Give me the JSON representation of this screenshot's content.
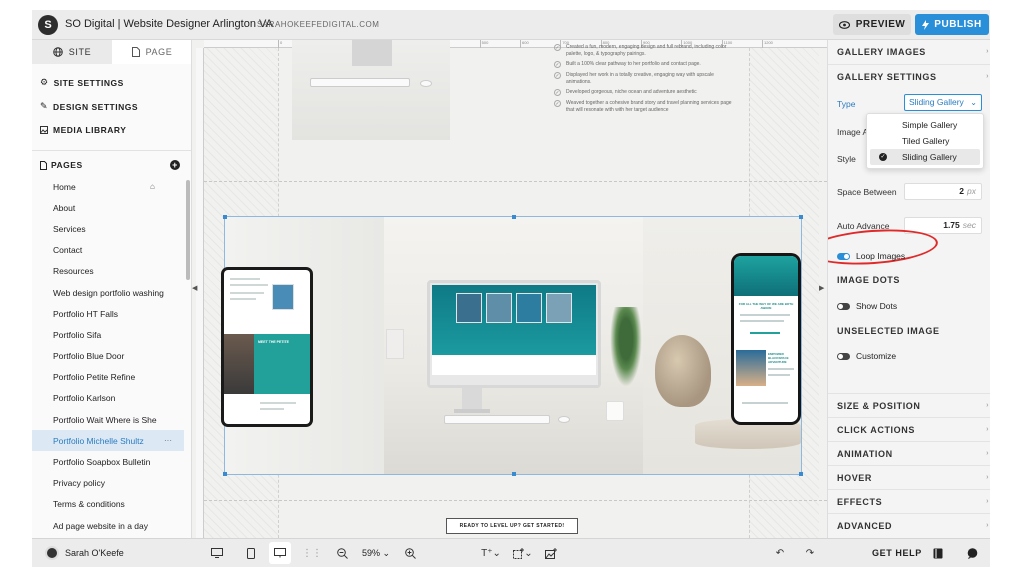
{
  "topbar": {
    "logo_glyph": "S",
    "site_title": "SO Digital | Website Designer Arlington VA",
    "site_url": "SARAHOKEEFEDIGITAL.COM",
    "preview_label": "PREVIEW",
    "publish_label": "PUBLISH"
  },
  "sidebar": {
    "tabs": [
      {
        "label": "SITE",
        "icon": "globe-icon"
      },
      {
        "label": "PAGE",
        "icon": "page-icon"
      }
    ],
    "menu": [
      {
        "label": "SITE SETTINGS",
        "icon": "gear-icon"
      },
      {
        "label": "DESIGN SETTINGS",
        "icon": "brush-icon"
      },
      {
        "label": "MEDIA LIBRARY",
        "icon": "image-icon"
      }
    ],
    "pages_title": "PAGES",
    "pages": [
      {
        "label": "Home"
      },
      {
        "label": "About"
      },
      {
        "label": "Services"
      },
      {
        "label": "Contact"
      },
      {
        "label": "Resources"
      },
      {
        "label": "Web design portfolio washing"
      },
      {
        "label": "Portfolio HT Falls"
      },
      {
        "label": "Portfolio Sifa"
      },
      {
        "label": "Portfolio Blue Door"
      },
      {
        "label": "Portfolio Petite Refine"
      },
      {
        "label": "Portfolio Karlson"
      },
      {
        "label": "Portfolio Wait Where is She"
      },
      {
        "label": "Portfolio Michelle Shultz"
      },
      {
        "label": "Portfolio Soapbox Bulletin"
      },
      {
        "label": "Privacy policy"
      },
      {
        "label": "Terms & conditions"
      },
      {
        "label": "Ad page website in a day"
      }
    ],
    "selected_page_index": 12,
    "selected_page_extra": "···",
    "home_icon": "⌂"
  },
  "canvas": {
    "ruler_ticks": [
      "0",
      "100",
      "200",
      "300",
      "400",
      "500",
      "600",
      "700",
      "800",
      "900",
      "1000",
      "1100",
      "1200"
    ],
    "bullets": [
      "Created a fun, modern, engaging design and full rebrand, including color palette, logo, & typography pairings.",
      "Built a 100% clear pathway to her portfolio and contact page.",
      "Displayed her work in a totally creative, engaging way with upscale animations.",
      "Developed gorgeous, niche ocean and adventure aesthetic",
      "Weaved together a cohesive brand story and travel planning services page that will resonate with with her target audience"
    ],
    "tablet_text": {
      "heading": "MEET THE PETITE",
      "phone_caption": "FOR ALL THE WHY OF WE ARE BOTH AWARE",
      "phone_heading": "EMPOWER BLACKSPACE ADVENTURE"
    },
    "cta_label": "READY TO LEVEL UP? GET STARTED!"
  },
  "panel": {
    "sections_top": [
      "GALLERY IMAGES",
      "GALLERY SETTINGS"
    ],
    "type_label": "Type",
    "type_value": "Sliding Gallery",
    "image_label": "Image A",
    "style_label": "Style",
    "dropdown_options": [
      "Simple Gallery",
      "Tiled Gallery",
      "Sliding Gallery"
    ],
    "dropdown_selected_index": 2,
    "space_between_label": "Space Between",
    "space_between_value": "2",
    "space_between_unit": "px",
    "auto_advance_label": "Auto Advance",
    "auto_advance_value": "1.75",
    "auto_advance_unit": "sec",
    "loop_images_label": "Loop Images",
    "loop_images_on": true,
    "image_dots_title": "IMAGE DOTS",
    "show_dots_label": "Show Dots",
    "show_dots_on": false,
    "unselected_image_title": "UNSELECTED IMAGE",
    "customize_label": "Customize",
    "customize_on": false,
    "sections_bottom": [
      "SIZE & POSITION",
      "CLICK ACTIONS",
      "ANIMATION",
      "HOVER",
      "EFFECTS",
      "ADVANCED"
    ]
  },
  "bottombar": {
    "user_name": "Sarah O'Keefe",
    "zoom": "59%",
    "get_help_label": "GET HELP"
  },
  "colors": {
    "accent": "#2a8fd9",
    "annotation_red": "#e02a2a",
    "teal_brand": "#22a19a"
  }
}
